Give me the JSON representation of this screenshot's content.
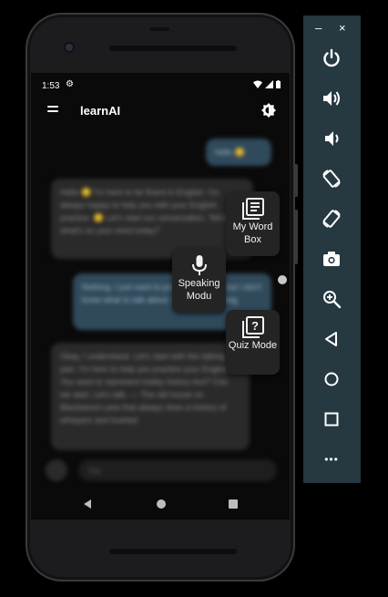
{
  "status_bar": {
    "time": "1:53"
  },
  "app_bar": {
    "title": "learnAI"
  },
  "chat": {
    "messages": [
      {
        "role": "user",
        "text": "hello 😊"
      },
      {
        "role": "ai",
        "text": "Hello 😊 I'm here to be fluent in English. I'm always happy to help you with your English practice. 😊 Let's start our conversation. Tell me, what's on your mind today?"
      },
      {
        "role": "user",
        "text": "Nothing, I just want to practice English, but I don't know what to talk about. Maybe something."
      },
      {
        "role": "ai",
        "text": "Okay, I understand. Let's start with the talking part. I'm here to help you practice your English. You want to represent hobby history text? Can we start, Let's talk. — The old house on Blackwood Lane that always does a history of whispers and hushed"
      }
    ]
  },
  "input": {
    "placeholder": "Say"
  },
  "fab_menu": {
    "word_box": "My Word Box",
    "speaking": "Speaking Modu",
    "quiz": "Quiz Mode"
  },
  "emulator": {
    "minimize": "–",
    "close": "×",
    "more": "•••"
  },
  "colors": {
    "fab_bg": "#242424",
    "emu_panel": "#263840",
    "user_bubble": "#304a5c"
  }
}
